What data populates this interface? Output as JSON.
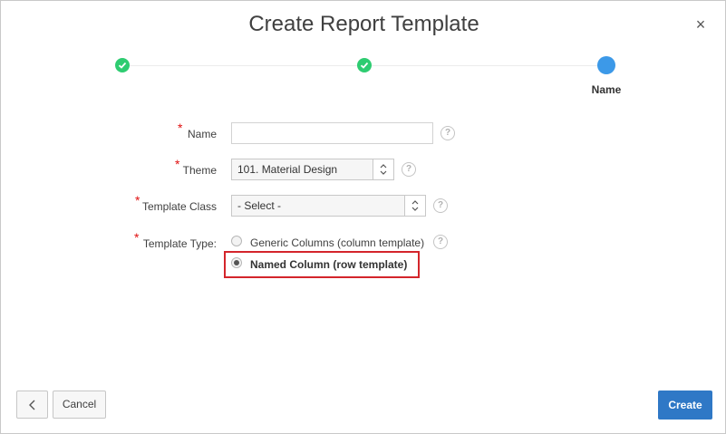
{
  "dialog": {
    "title": "Create Report Template",
    "close_label": "×"
  },
  "wizard": {
    "steps": [
      {
        "state": "complete"
      },
      {
        "state": "complete"
      },
      {
        "state": "current",
        "label": "Name"
      }
    ],
    "colors": {
      "complete": "#2ecc71",
      "current": "#3c99e8"
    }
  },
  "form": {
    "required_marker": "*",
    "help_glyph": "?",
    "name": {
      "label": "Name",
      "value": ""
    },
    "theme": {
      "label": "Theme",
      "value": "101. Material Design"
    },
    "template_class": {
      "label": "Template Class",
      "value": "- Select -"
    },
    "template_type": {
      "label": "Template Type:",
      "options": [
        {
          "label": "Generic Columns (column template)",
          "selected": false
        },
        {
          "label": "Named Column (row template)",
          "selected": true
        }
      ]
    }
  },
  "footer": {
    "back_icon": "chevron-left-icon",
    "cancel_label": "Cancel",
    "create_label": "Create",
    "primary_color": "#2f78c6"
  },
  "annotation": {
    "highlight_color": "#d4252b"
  }
}
